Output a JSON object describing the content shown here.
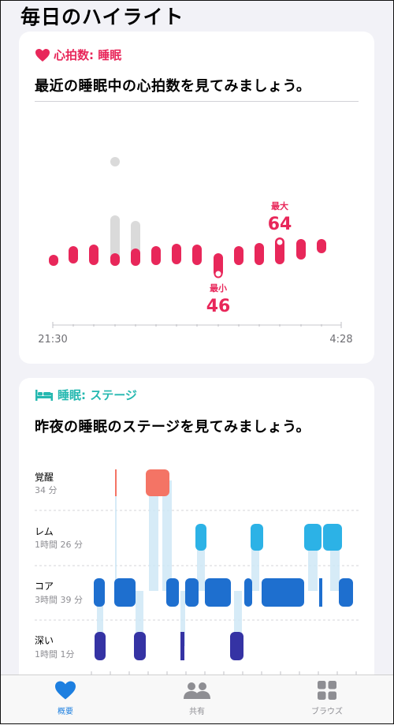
{
  "page": {
    "title": "毎日のハイライト"
  },
  "heart_card": {
    "category": "心拍数: 睡眠",
    "question": "最近の睡眠中の心拍数を見てみましょう。",
    "x_start": "21:30",
    "x_end": "4:28",
    "max_label": "最大",
    "max_value": "64",
    "min_label": "最小",
    "min_value": "46",
    "colors": {
      "accent": "#e8275a",
      "gray": "#dadada"
    }
  },
  "sleep_card": {
    "category": "睡眠: ステージ",
    "question": "昨夜の睡眠のステージを見てみましょう。",
    "stages": [
      {
        "name": "覚醒",
        "duration": "34 分",
        "color": "#f47465"
      },
      {
        "name": "レム",
        "duration": "1時間 26 分",
        "color": "#2cb2e6"
      },
      {
        "name": "コア",
        "duration": "3時間 39 分",
        "color": "#1e6fcf"
      },
      {
        "name": "深い",
        "duration": "1時間 1分",
        "color": "#3533a4"
      }
    ]
  },
  "tabbar": {
    "tabs": [
      {
        "label": "概要",
        "icon": "heart-icon",
        "selected": true
      },
      {
        "label": "共有",
        "icon": "people-icon",
        "selected": false
      },
      {
        "label": "ブラウズ",
        "icon": "grid-icon",
        "selected": false
      }
    ]
  }
}
